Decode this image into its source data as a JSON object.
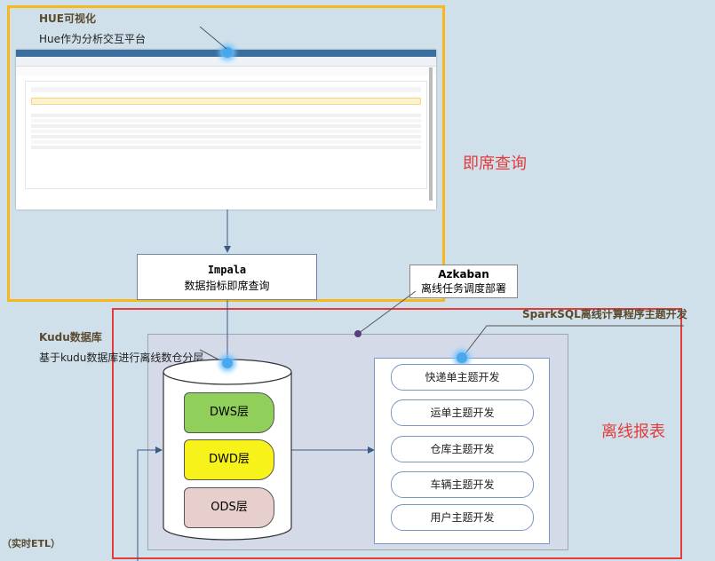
{
  "hue": {
    "title": "HUE可视化",
    "subtitle": "Hue作为分析交互平台"
  },
  "label_adhoc": "即席查询",
  "label_offline": "离线报表",
  "impala": {
    "title": "Impala",
    "subtitle": "数据指标即席查询"
  },
  "azkaban": {
    "title": "Azkaban",
    "subtitle": "离线任务调度部署"
  },
  "sparksql": {
    "title": "SparkSQL离线计算程序主题开发"
  },
  "kudu": {
    "title": "Kudu数据库",
    "subtitle": "基于kudu数据库进行离线数仓分层"
  },
  "layers": [
    "DWS层",
    "DWD层",
    "ODS层"
  ],
  "topics": [
    "快递单主题开发",
    "运单主题开发",
    "仓库主题开发",
    "车辆主题开发",
    "用户主题开发"
  ],
  "etl_label": "（实时ETL）",
  "colors": {
    "yellow": "#f6b81a",
    "red": "#e43b3b",
    "dws": "#8fcf5a",
    "dwd": "#f7f21a",
    "ods": "#e6cfcd"
  }
}
